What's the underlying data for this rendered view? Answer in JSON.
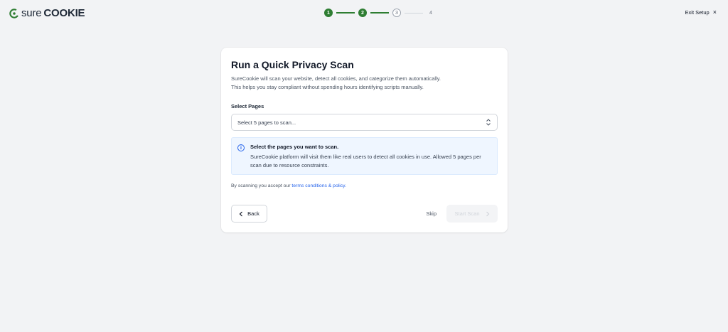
{
  "header": {
    "logo_sure": "SURE",
    "logo_cookie": "COOKIE",
    "exit_label": "Exit Setup",
    "exit_icon": "×"
  },
  "stepper": {
    "steps": [
      "1",
      "2",
      "3",
      "4"
    ],
    "accent": "#2e7d32"
  },
  "card": {
    "title": "Run a Quick Privacy Scan",
    "desc_line1": "SureCookie will scan your website, detect all cookies, and categorize them automatically.",
    "desc_line2": "This helps you stay compliant without spending hours identifying scripts manually.",
    "select_label": "Select Pages",
    "select_placeholder": "Select 5 pages to scan...",
    "info_title": "Select the pages you want to scan.",
    "info_text": "SureCookie platform will visit them like real users to detect all cookies in use. Allowed 5 pages per scan due to resource constraints.",
    "terms_prefix": "By scanning you accept our ",
    "terms_link": "terms conditions & policy.",
    "back_label": "Back",
    "skip_label": "Skip",
    "start_label": "Start Scan"
  }
}
